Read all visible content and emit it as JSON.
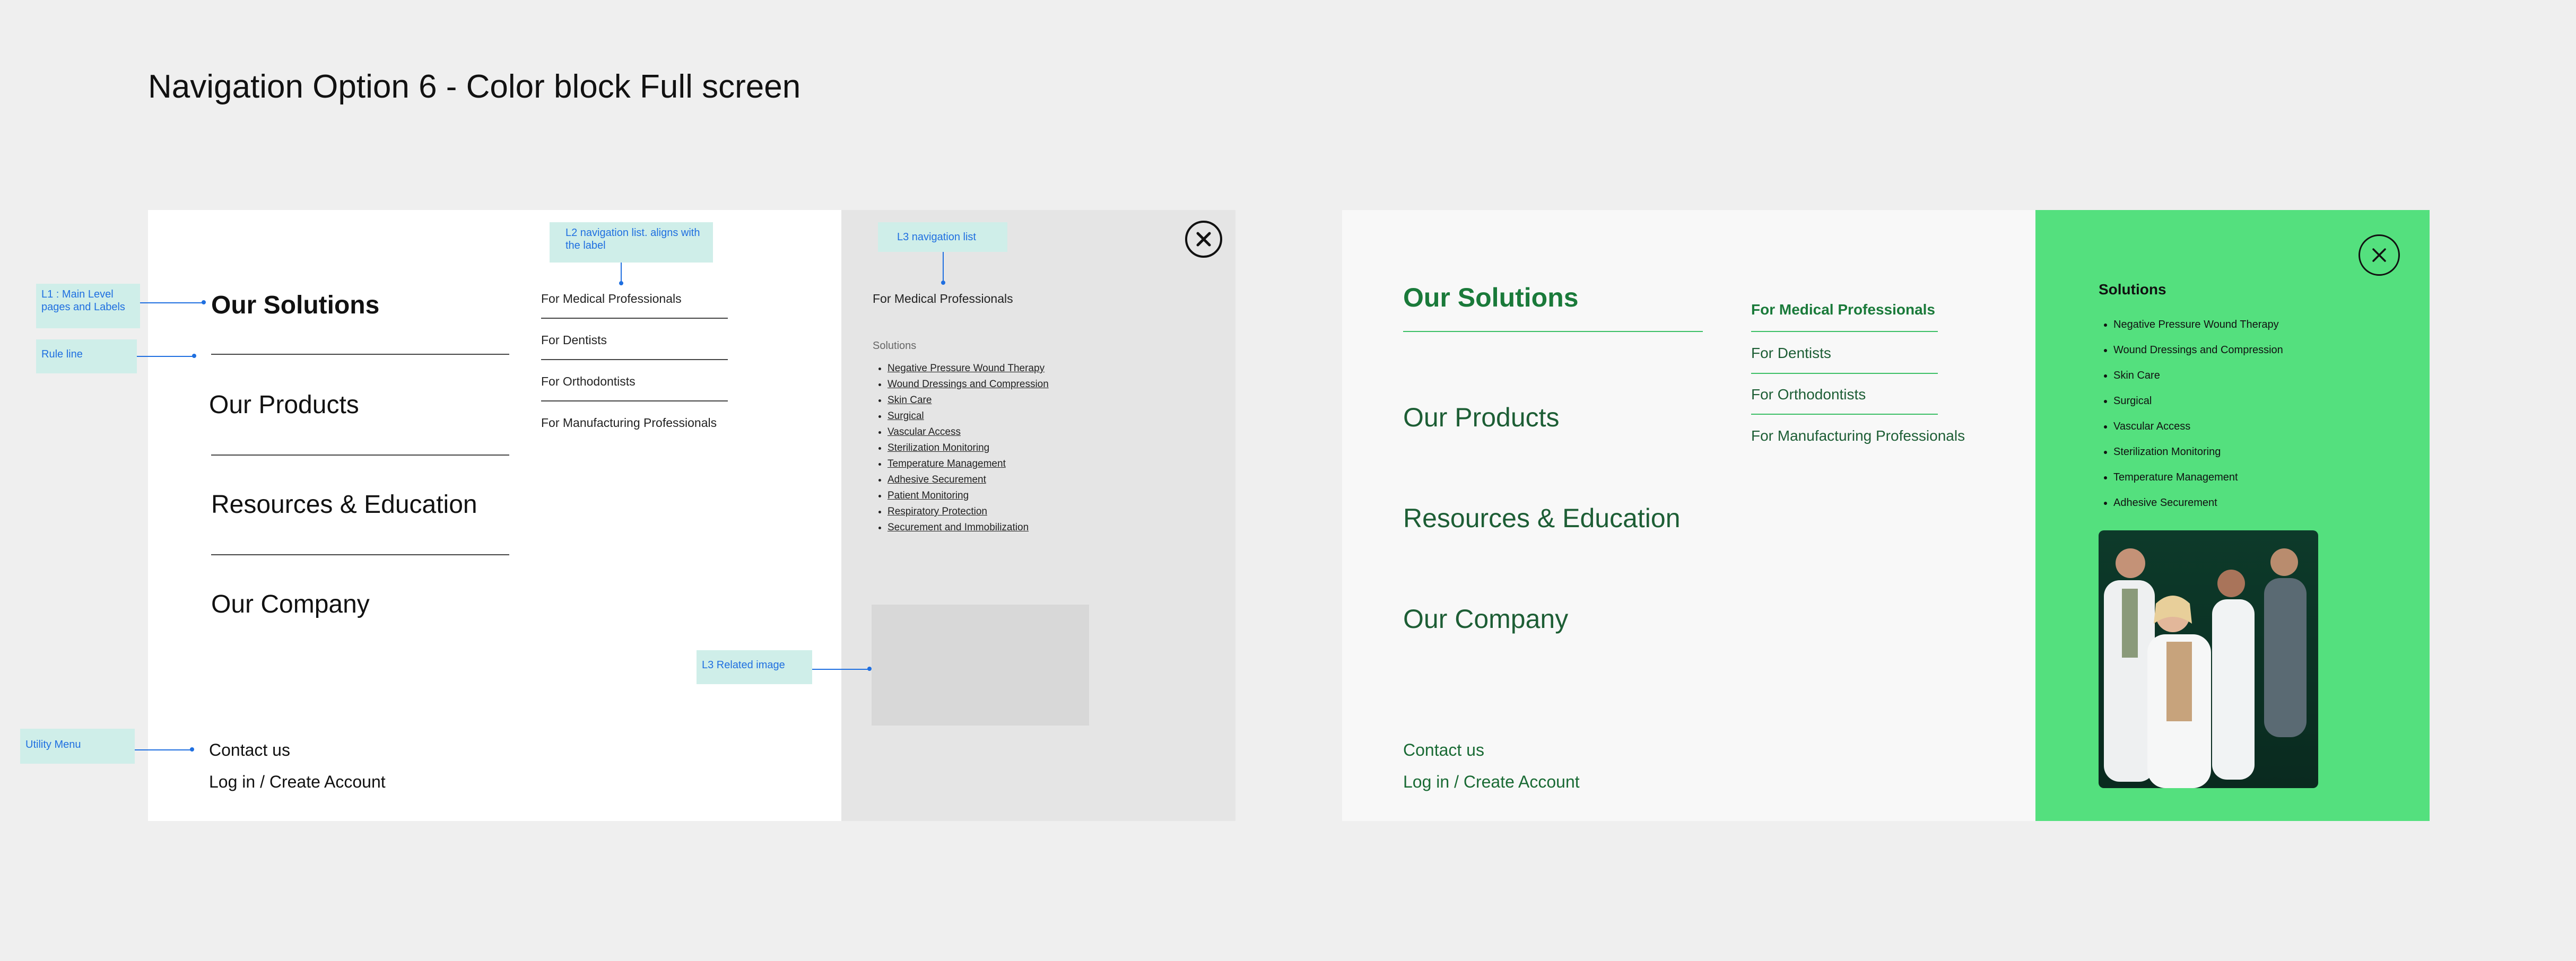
{
  "page_title": "Navigation Option 6 - Color block Full screen",
  "wireframe": {
    "l1_items": [
      "Our Solutions",
      "Our Products",
      "Resources & Education",
      "Our Company"
    ],
    "l2_items": [
      "For Medical Professionals",
      "For Dentists",
      "For Orthodontists",
      "For Manufacturing Professionals"
    ],
    "l3_heading": "For Medical Professionals",
    "l3_subheading": "Solutions",
    "l3_items": [
      "Negative Pressure Wound Therapy",
      "Wound Dressings and Compression",
      "Skin Care",
      "Surgical",
      "Vascular Access",
      "Sterilization Monitoring",
      "Temperature Management",
      "Adhesive Securement",
      "Patient Monitoring",
      "Respiratory Protection",
      "Securement and Immobilization"
    ],
    "utility": [
      "Contact us",
      "Log in / Create Account"
    ]
  },
  "annotations": {
    "l1": "L1 : Main Level pages and Labels",
    "rule": "Rule line",
    "utility": "Utility Menu",
    "l2": "L2 navigation list. aligns with the label",
    "l3": "L3 navigation list",
    "l3_image": "L3 Related image"
  },
  "colorblock": {
    "l1_items": [
      "Our Solutions",
      "Our Products",
      "Resources & Education",
      "Our Company"
    ],
    "l2_items": [
      "For Medical Professionals",
      "For Dentists",
      "For Orthodontists",
      "For Manufacturing Professionals"
    ],
    "l3_heading": "Solutions",
    "l3_items": [
      "Negative Pressure Wound Therapy",
      "Wound Dressings and Compression",
      "Skin Care",
      "Surgical",
      "Vascular Access",
      "Sterilization Monitoring",
      "Temperature Management",
      "Adhesive Securement"
    ],
    "utility": [
      "Contact us",
      "Log in / Create Account"
    ]
  },
  "colors": {
    "panel_green": "#54e07e",
    "text_green": "#1d5e35",
    "annotation_bg": "#cfeee9",
    "annotation_text": "#1f6fe0"
  },
  "icons": {
    "close": "close-icon"
  }
}
